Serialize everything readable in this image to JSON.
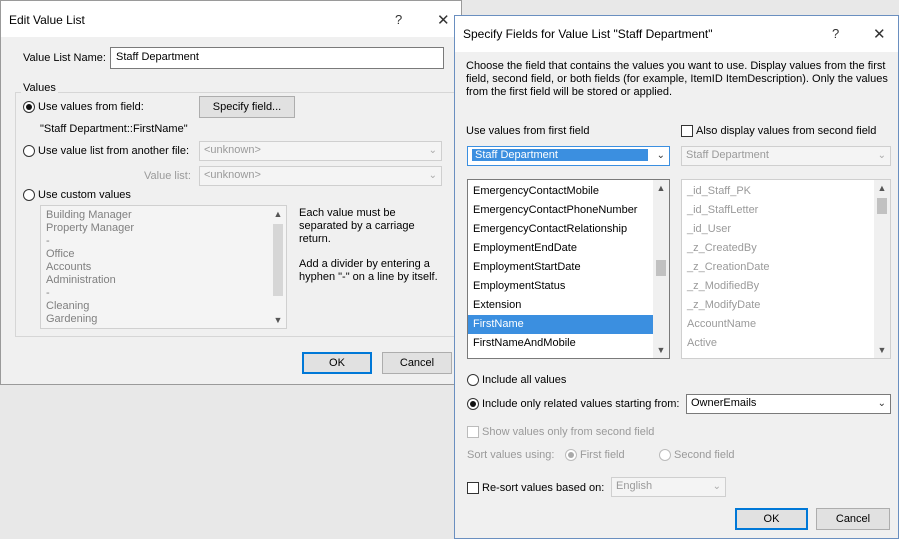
{
  "edit_value_list": {
    "title": "Edit Value List",
    "help": "?",
    "close": "✕",
    "name_label": "Value List Name:",
    "name_value": "Staff Department",
    "values_group": "Values",
    "opt_from_field": "Use values from field:",
    "specify_field_btn": "Specify field...",
    "field_ref": "\"Staff Department::FirstName\"",
    "opt_from_file": "Use value list from another file:",
    "file_combo": "<unknown>",
    "value_list_label": "Value list:",
    "value_list_combo": "<unknown>",
    "opt_custom": "Use custom values",
    "custom_values": [
      "Building Manager",
      "Property Manager",
      "-",
      "Office",
      "Accounts",
      "Administration",
      "-",
      "Cleaning",
      "Gardening"
    ],
    "help_text_1": "Each value must be separated by a carriage return.",
    "help_text_2": "Add a divider by entering a hyphen \"-\" on a line by itself.",
    "ok": "OK",
    "cancel": "Cancel"
  },
  "specify_fields": {
    "title": "Specify Fields for Value List \"Staff Department\"",
    "help": "?",
    "close": "✕",
    "description": "Choose the field that contains the values you want to use. Display values from the first field, second field, or both fields (for example, ItemID ItemDescription). Only the values from the first field will be stored or applied.",
    "first_field_label": "Use values from first field",
    "first_table": "Staff Department",
    "also_display_label": "Also display values from second field",
    "second_table": "Staff Department",
    "first_fields": [
      "EmergencyContactMobile",
      "EmergencyContactPhoneNumber",
      "EmergencyContactRelationship",
      "EmploymentEndDate",
      "EmploymentStartDate",
      "EmploymentStatus",
      "Extension",
      "FirstName",
      "FirstNameAndMobile"
    ],
    "selected_first_field": "FirstName",
    "second_fields": [
      "_id_Staff_PK",
      "_id_StaffLetter",
      "_id_User",
      "_z_CreatedBy",
      "_z_CreationDate",
      "_z_ModifiedBy",
      "_z_ModifyDate",
      "AccountName",
      "Active"
    ],
    "include_all": "Include all values",
    "include_related": "Include only related values starting from:",
    "related_table": "OwnerEmails",
    "show_second_only": "Show values only from second field",
    "sort_label": "Sort values using:",
    "sort_first": "First field",
    "sort_second": "Second field",
    "resort_label": "Re-sort values based on:",
    "language": "English",
    "ok": "OK",
    "cancel": "Cancel"
  }
}
